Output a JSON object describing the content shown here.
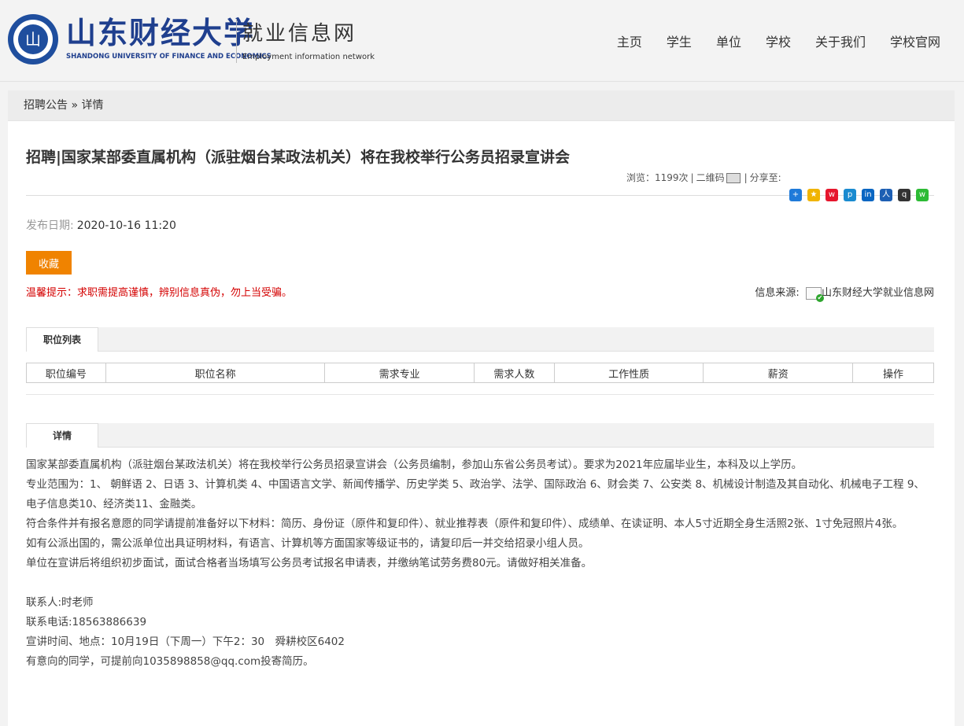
{
  "header": {
    "logo_cn": "山东财经大学",
    "logo_en": "SHANDONG UNIVERSITY OF FINANCE AND ECONOMICS",
    "site_cn": "就业信息网",
    "site_en": "Employment information network",
    "nav": [
      "主页",
      "学生",
      "单位",
      "学校",
      "关于我们",
      "学校官网"
    ]
  },
  "breadcrumb": {
    "parent": "招聘公告",
    "sep": " » ",
    "current": "详情"
  },
  "article": {
    "title": "招聘|国家某部委直属机构（派驻烟台某政法机关）将在我校举行公务员招录宣讲会",
    "views_label": "浏览：",
    "views": "1199次",
    "qr_label": "二维码",
    "share_label": "分享至:",
    "pub_label": "发布日期:",
    "pub_date": "2020-10-16 11:20",
    "fav_label": "收藏",
    "tip": "温馨提示：求职需提高谨慎，辨别信息真伪，勿上当受骗。",
    "source_label": "信息来源:",
    "source": "山东财经大学就业信息网"
  },
  "share_icons": [
    {
      "name": "more-share-icon",
      "color": "#1f7ad9",
      "glyph": "+"
    },
    {
      "name": "qzone-icon",
      "color": "#f0b400",
      "glyph": "★"
    },
    {
      "name": "weibo-icon",
      "color": "#e6162d",
      "glyph": "w"
    },
    {
      "name": "tencent-weibo-icon",
      "color": "#1a8bd0",
      "glyph": "p"
    },
    {
      "name": "linkedin-icon",
      "color": "#0a66c2",
      "glyph": "in"
    },
    {
      "name": "renren-icon",
      "color": "#1d5fb3",
      "glyph": "人"
    },
    {
      "name": "qq-icon",
      "color": "#333333",
      "glyph": "q"
    },
    {
      "name": "wechat-icon",
      "color": "#2dbb35",
      "glyph": "w"
    }
  ],
  "jobs": {
    "tab": "职位列表",
    "columns": [
      "职位编号",
      "职位名称",
      "需求专业",
      "需求人数",
      "工作性质",
      "薪资",
      "操作"
    ]
  },
  "detail": {
    "tab": "详情",
    "paragraphs": [
      "国家某部委直属机构（派驻烟台某政法机关）将在我校举行公务员招录宣讲会（公务员编制，参加山东省公务员考试）。要求为2021年应届毕业生，本科及以上学历。",
      "专业范围为：1、 朝鲜语 2、日语 3、计算机类 4、中国语言文学、新闻传播学、历史学类 5、政治学、法学、国际政治 6、财会类 7、公安类 8、机械设计制造及其自动化、机械电子工程 9、电子信息类10、经济类11、金融类。",
      "符合条件并有报名意愿的同学请提前准备好以下材料：简历、身份证（原件和复印件）、就业推荐表（原件和复印件）、成绩单、在读证明、本人5寸近期全身生活照2张、1寸免冠照片4张。",
      "如有公派出国的，需公派单位出具证明材料，有语言、计算机等方面国家等级证书的，请复印后一并交给招录小组人员。",
      "单位在宣讲后将组织初步面试，面试合格者当场填写公务员考试报名申请表，并缴纳笔试劳务费80元。请做好相关准备。"
    ],
    "contact": [
      "联系人:时老师",
      "联系电话:18563886639",
      "宣讲时间、地点：10月19日（下周一）下午2：30　舜耕校区6402",
      "有意向的同学，可提前向1035898858@qq.com投寄简历。"
    ]
  }
}
